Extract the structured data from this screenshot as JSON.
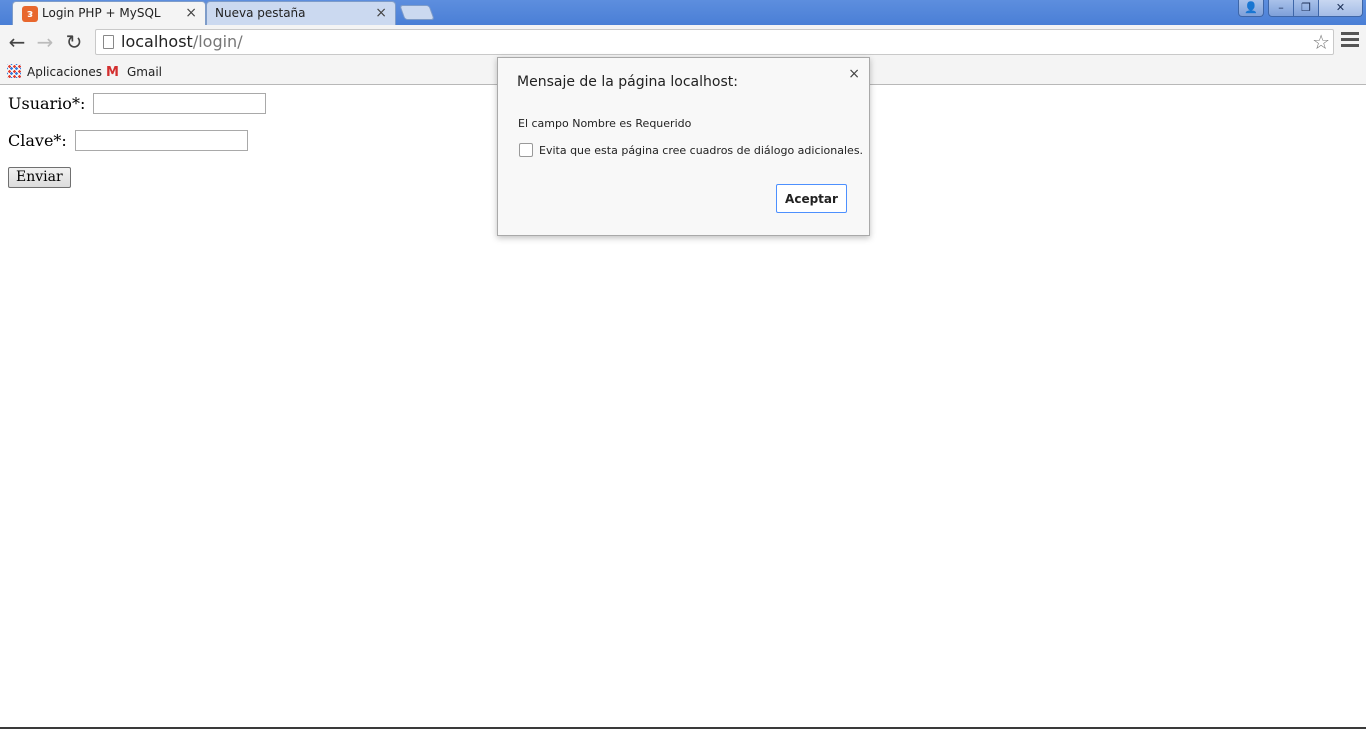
{
  "browser": {
    "tabs": [
      {
        "label": "Login PHP + MySQL",
        "active": true
      },
      {
        "label": "Nueva pestaña",
        "active": false
      }
    ],
    "close_glyph": "×",
    "url_host": "localhost",
    "url_path": "/login/",
    "bookmarks": [
      {
        "label": "Aplicaciones",
        "icon": "apps-grid-icon"
      },
      {
        "label": "Gmail",
        "icon": "gmail-icon"
      }
    ]
  },
  "form": {
    "user_label": "Usuario*:",
    "user_value": "",
    "pass_label": "Clave*:",
    "pass_value": "",
    "submit_label": "Enviar"
  },
  "dialog": {
    "title": "Mensaje de la página localhost:",
    "message": "El campo Nombre es Requerido",
    "checkbox_label": "Evita que esta página cree cuadros de diálogo adicionales.",
    "checkbox_checked": false,
    "button_label": "Aceptar",
    "close_glyph": "×"
  },
  "colors": {
    "titlebar": "#4a7fd6",
    "accent_button_border": "#4d90fe",
    "favicon": "#e8672d"
  }
}
